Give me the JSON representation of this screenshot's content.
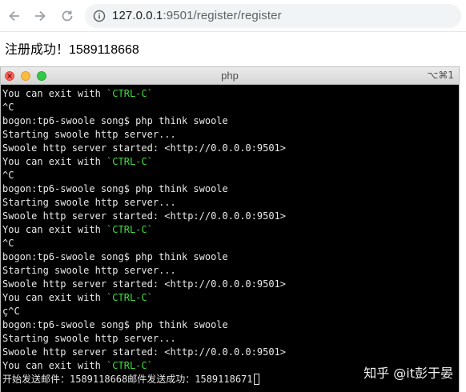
{
  "browser": {
    "url_host": "127.0.0.1",
    "url_rest": ":9501/register/register"
  },
  "page": {
    "message": "注册成功！1589118668"
  },
  "terminal": {
    "title": "php",
    "shortcut": "⌥⌘1",
    "lines": [
      {
        "text": "You can exit with ",
        "green": "`CTRL-C`"
      },
      {
        "text": "^C"
      },
      {
        "text": "bogon:tp6-swoole song$ php think swoole"
      },
      {
        "text": "Starting swoole http server..."
      },
      {
        "text": "Swoole http server started: <http://0.0.0.0:9501>"
      },
      {
        "text": "You can exit with ",
        "green": "`CTRL-C`"
      },
      {
        "text": "^C"
      },
      {
        "text": "bogon:tp6-swoole song$ php think swoole"
      },
      {
        "text": "Starting swoole http server..."
      },
      {
        "text": "Swoole http server started: <http://0.0.0.0:9501>"
      },
      {
        "text": "You can exit with ",
        "green": "`CTRL-C`"
      },
      {
        "text": "^C"
      },
      {
        "text": "bogon:tp6-swoole song$ php think swoole"
      },
      {
        "text": "Starting swoole http server..."
      },
      {
        "text": "Swoole http server started: <http://0.0.0.0:9501>"
      },
      {
        "text": "You can exit with ",
        "green": "`CTRL-C`"
      },
      {
        "text": "ç^C"
      },
      {
        "text": "bogon:tp6-swoole song$ php think swoole"
      },
      {
        "text": "Starting swoole http server..."
      },
      {
        "text": "Swoole http server started: <http://0.0.0.0:9501>"
      },
      {
        "text": "You can exit with ",
        "green": "`CTRL-C`"
      },
      {
        "text": "开始发送邮件：1589118668邮件发送成功：1589118671",
        "cursor": true
      }
    ]
  },
  "watermark": "知乎 @it彭于晏"
}
